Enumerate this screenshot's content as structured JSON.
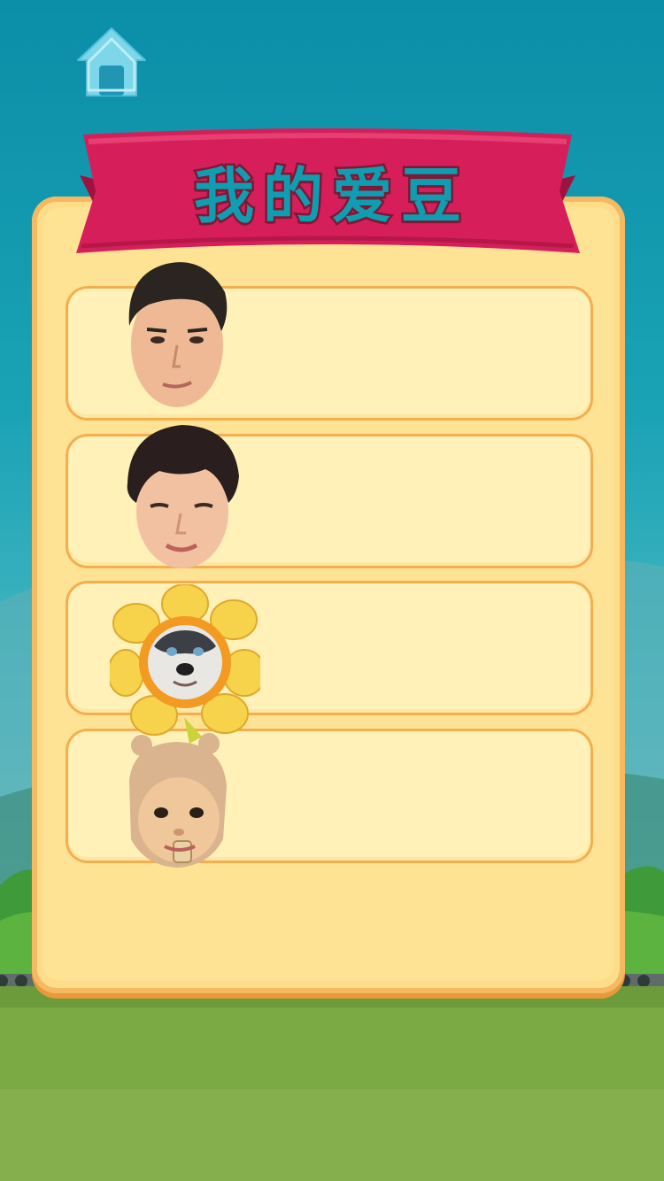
{
  "title": "我的爱豆",
  "home_button": {
    "icon": "home-icon"
  },
  "colors": {
    "sky": "#0b8ea8",
    "panel": "#fedd8a",
    "panel_border": "#f4ad4f",
    "ribbon": "#d61f5a",
    "title_text": "#119db1",
    "home_icon": "#7ed6ea",
    "grass": "#7ba944"
  },
  "idols": [
    {
      "avatar": "male-face-1-avatar"
    },
    {
      "avatar": "male-face-2-avatar"
    },
    {
      "avatar": "husky-sunflower-avatar"
    },
    {
      "avatar": "baby-bear-hat-avatar"
    }
  ]
}
